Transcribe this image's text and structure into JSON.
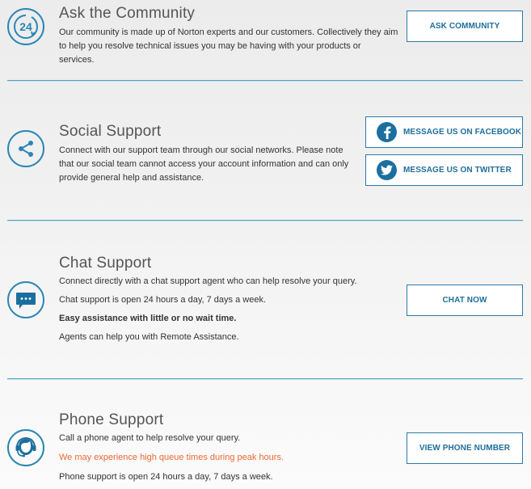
{
  "colors": {
    "accent": "#2a86b4",
    "button_text": "#1f6e9a",
    "warning_text": "#e96a33",
    "divider": "#5aa0bd"
  },
  "sections": {
    "community": {
      "icon": "24-hour-support-icon",
      "title": "Ask the Community",
      "description": "Our community is made up of Norton experts and our customers. Collectively they aim to help you resolve technical issues you may be having with your products or services.",
      "button_label": "ASK COMMUNITY"
    },
    "social": {
      "icon": "share-icon",
      "title": "Social Support",
      "description": "Connect with our support team through our social networks. Please note that our social team cannot access your account information and can only provide general help and assistance.",
      "facebook_button_label": "MESSAGE US ON FACEBOOK",
      "facebook_icon": "facebook-icon",
      "twitter_button_label": "MESSAGE US ON TWITTER",
      "twitter_icon": "twitter-icon"
    },
    "chat": {
      "icon": "chat-bubble-icon",
      "title": "Chat Support",
      "lines": [
        "Connect directly with a chat support agent who can help resolve your query.",
        "Chat support is open 24 hours a day, 7 days a week.",
        "Easy assistance with little or no wait time.",
        "Agents can help you with Remote Assistance."
      ],
      "button_label": "CHAT NOW"
    },
    "phone": {
      "icon": "headset-agent-icon",
      "title": "Phone Support",
      "lines": [
        "Call a phone agent to help resolve your query.",
        "We may experience high queue times during peak hours.",
        "Phone support is open 24 hours a day, 7 days a week."
      ],
      "button_label": "VIEW PHONE NUMBER"
    }
  }
}
